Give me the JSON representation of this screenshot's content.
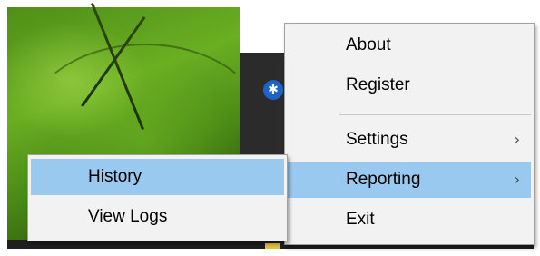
{
  "main_menu": {
    "items": [
      {
        "label": "About"
      },
      {
        "label": "Register"
      },
      {
        "label": "Settings",
        "submenu_icon": "chevron-right-icon"
      },
      {
        "label": "Reporting",
        "submenu_icon": "chevron-right-icon",
        "highlighted": true
      },
      {
        "label": "Exit"
      }
    ]
  },
  "sub_menu": {
    "parent": "Reporting",
    "items": [
      {
        "label": "History",
        "highlighted": true
      },
      {
        "label": "View Logs"
      }
    ]
  },
  "tray": {
    "icon": "bluetooth-icon"
  },
  "colors": {
    "menu_background": "#f2f2f2",
    "highlight": "#99c9ef",
    "border": "#a0a0a0",
    "tray_icon": "#1e63c8"
  }
}
